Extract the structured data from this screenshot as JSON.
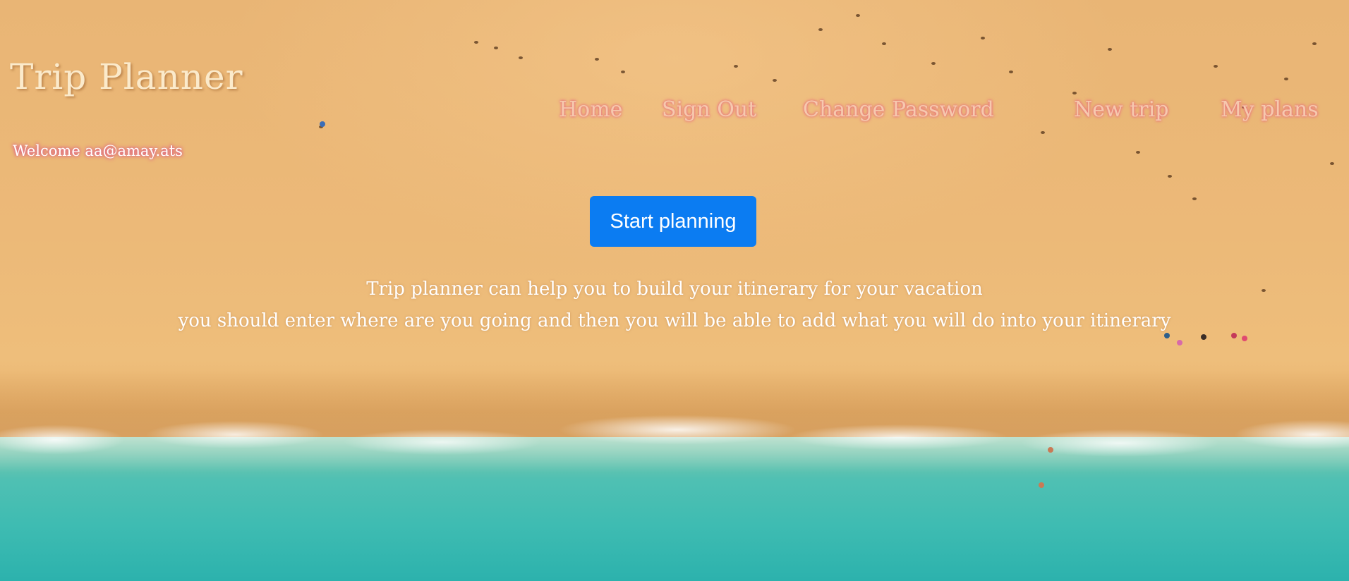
{
  "header": {
    "title": "Trip Planner",
    "welcome": "Welcome aa@amay.ats"
  },
  "nav": {
    "items": [
      {
        "label": "Home"
      },
      {
        "label": "Sign Out"
      },
      {
        "label": "Change Password"
      },
      {
        "label": "New trip"
      },
      {
        "label": "My plans"
      }
    ]
  },
  "main": {
    "start_button": "Start planning",
    "intro_line_1": "Trip planner can help you to build your itinerary for your vacation",
    "intro_line_2": "you should enter where are you going and then you will be able to add what you will do into your itinerary"
  },
  "colors": {
    "button": "#0b7cf2",
    "nav_text": "#f6c9ae",
    "title_text": "#fbeacb"
  }
}
